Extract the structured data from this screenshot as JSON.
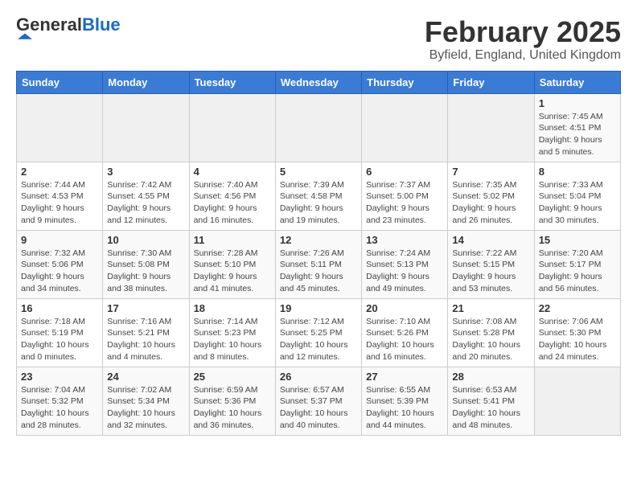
{
  "header": {
    "logo_general": "General",
    "logo_blue": "Blue",
    "month_title": "February 2025",
    "location": "Byfield, England, United Kingdom"
  },
  "days_of_week": [
    "Sunday",
    "Monday",
    "Tuesday",
    "Wednesday",
    "Thursday",
    "Friday",
    "Saturday"
  ],
  "weeks": [
    [
      {
        "day": "",
        "info": ""
      },
      {
        "day": "",
        "info": ""
      },
      {
        "day": "",
        "info": ""
      },
      {
        "day": "",
        "info": ""
      },
      {
        "day": "",
        "info": ""
      },
      {
        "day": "",
        "info": ""
      },
      {
        "day": "1",
        "info": "Sunrise: 7:45 AM\nSunset: 4:51 PM\nDaylight: 9 hours and 5 minutes."
      }
    ],
    [
      {
        "day": "2",
        "info": "Sunrise: 7:44 AM\nSunset: 4:53 PM\nDaylight: 9 hours and 9 minutes."
      },
      {
        "day": "3",
        "info": "Sunrise: 7:42 AM\nSunset: 4:55 PM\nDaylight: 9 hours and 12 minutes."
      },
      {
        "day": "4",
        "info": "Sunrise: 7:40 AM\nSunset: 4:56 PM\nDaylight: 9 hours and 16 minutes."
      },
      {
        "day": "5",
        "info": "Sunrise: 7:39 AM\nSunset: 4:58 PM\nDaylight: 9 hours and 19 minutes."
      },
      {
        "day": "6",
        "info": "Sunrise: 7:37 AM\nSunset: 5:00 PM\nDaylight: 9 hours and 23 minutes."
      },
      {
        "day": "7",
        "info": "Sunrise: 7:35 AM\nSunset: 5:02 PM\nDaylight: 9 hours and 26 minutes."
      },
      {
        "day": "8",
        "info": "Sunrise: 7:33 AM\nSunset: 5:04 PM\nDaylight: 9 hours and 30 minutes."
      }
    ],
    [
      {
        "day": "9",
        "info": "Sunrise: 7:32 AM\nSunset: 5:06 PM\nDaylight: 9 hours and 34 minutes."
      },
      {
        "day": "10",
        "info": "Sunrise: 7:30 AM\nSunset: 5:08 PM\nDaylight: 9 hours and 38 minutes."
      },
      {
        "day": "11",
        "info": "Sunrise: 7:28 AM\nSunset: 5:10 PM\nDaylight: 9 hours and 41 minutes."
      },
      {
        "day": "12",
        "info": "Sunrise: 7:26 AM\nSunset: 5:11 PM\nDaylight: 9 hours and 45 minutes."
      },
      {
        "day": "13",
        "info": "Sunrise: 7:24 AM\nSunset: 5:13 PM\nDaylight: 9 hours and 49 minutes."
      },
      {
        "day": "14",
        "info": "Sunrise: 7:22 AM\nSunset: 5:15 PM\nDaylight: 9 hours and 53 minutes."
      },
      {
        "day": "15",
        "info": "Sunrise: 7:20 AM\nSunset: 5:17 PM\nDaylight: 9 hours and 56 minutes."
      }
    ],
    [
      {
        "day": "16",
        "info": "Sunrise: 7:18 AM\nSunset: 5:19 PM\nDaylight: 10 hours and 0 minutes."
      },
      {
        "day": "17",
        "info": "Sunrise: 7:16 AM\nSunset: 5:21 PM\nDaylight: 10 hours and 4 minutes."
      },
      {
        "day": "18",
        "info": "Sunrise: 7:14 AM\nSunset: 5:23 PM\nDaylight: 10 hours and 8 minutes."
      },
      {
        "day": "19",
        "info": "Sunrise: 7:12 AM\nSunset: 5:25 PM\nDaylight: 10 hours and 12 minutes."
      },
      {
        "day": "20",
        "info": "Sunrise: 7:10 AM\nSunset: 5:26 PM\nDaylight: 10 hours and 16 minutes."
      },
      {
        "day": "21",
        "info": "Sunrise: 7:08 AM\nSunset: 5:28 PM\nDaylight: 10 hours and 20 minutes."
      },
      {
        "day": "22",
        "info": "Sunrise: 7:06 AM\nSunset: 5:30 PM\nDaylight: 10 hours and 24 minutes."
      }
    ],
    [
      {
        "day": "23",
        "info": "Sunrise: 7:04 AM\nSunset: 5:32 PM\nDaylight: 10 hours and 28 minutes."
      },
      {
        "day": "24",
        "info": "Sunrise: 7:02 AM\nSunset: 5:34 PM\nDaylight: 10 hours and 32 minutes."
      },
      {
        "day": "25",
        "info": "Sunrise: 6:59 AM\nSunset: 5:36 PM\nDaylight: 10 hours and 36 minutes."
      },
      {
        "day": "26",
        "info": "Sunrise: 6:57 AM\nSunset: 5:37 PM\nDaylight: 10 hours and 40 minutes."
      },
      {
        "day": "27",
        "info": "Sunrise: 6:55 AM\nSunset: 5:39 PM\nDaylight: 10 hours and 44 minutes."
      },
      {
        "day": "28",
        "info": "Sunrise: 6:53 AM\nSunset: 5:41 PM\nDaylight: 10 hours and 48 minutes."
      },
      {
        "day": "",
        "info": ""
      }
    ]
  ]
}
